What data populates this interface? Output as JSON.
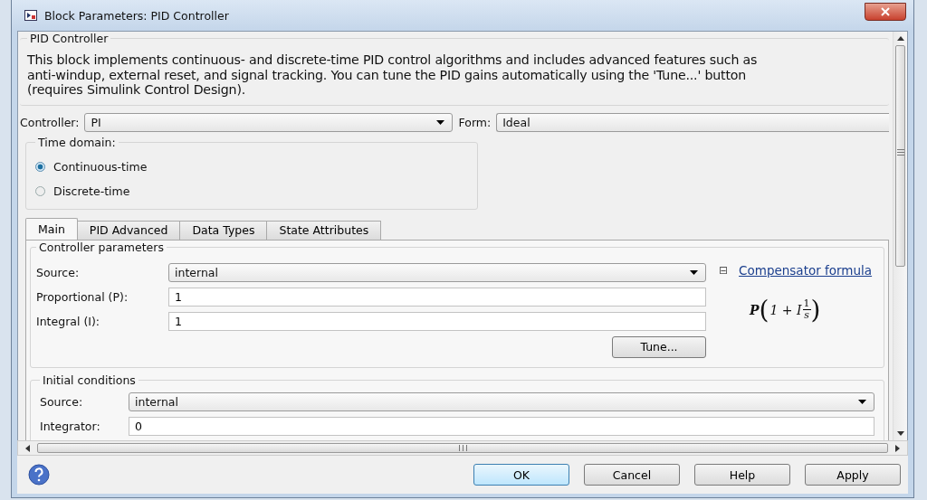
{
  "window": {
    "title": "Block Parameters: PID Controller"
  },
  "block": {
    "title": "PID Controller",
    "description": [
      "This block implements continuous- and discrete-time PID control algorithms and includes advanced features such as",
      "anti-windup, external reset, and signal tracking. You can tune the PID gains automatically using the 'Tune...' button",
      "(requires Simulink Control Design)."
    ]
  },
  "controller": {
    "label": "Controller:",
    "value": "PI"
  },
  "form": {
    "label": "Form:",
    "value": "Ideal"
  },
  "time_domain": {
    "title": "Time domain:",
    "options": [
      {
        "label": "Continuous-time",
        "selected": true
      },
      {
        "label": "Discrete-time",
        "selected": false
      }
    ]
  },
  "tabs": [
    {
      "label": "Main",
      "selected": true
    },
    {
      "label": "PID Advanced",
      "selected": false
    },
    {
      "label": "Data Types",
      "selected": false
    },
    {
      "label": "State Attributes",
      "selected": false
    }
  ],
  "controller_parameters": {
    "title": "Controller parameters",
    "source": {
      "label": "Source:",
      "value": "internal"
    },
    "proportional": {
      "label": "Proportional (P):",
      "value": "1"
    },
    "integral": {
      "label": "Integral (I):",
      "value": "1"
    },
    "tune_button": "Tune...",
    "compensator_toggle": "⊟",
    "compensator_link": "Compensator formula",
    "formula": {
      "lead": "P",
      "open": "(",
      "body": "1 + I",
      "numerator": "1",
      "denominator": "s",
      "close": ")"
    }
  },
  "initial_conditions": {
    "title": "Initial conditions",
    "source": {
      "label": "Source:",
      "value": "internal"
    },
    "integrator": {
      "label": "Integrator:",
      "value": "0"
    }
  },
  "buttons": [
    "OK",
    "Cancel",
    "Help",
    "Apply"
  ]
}
